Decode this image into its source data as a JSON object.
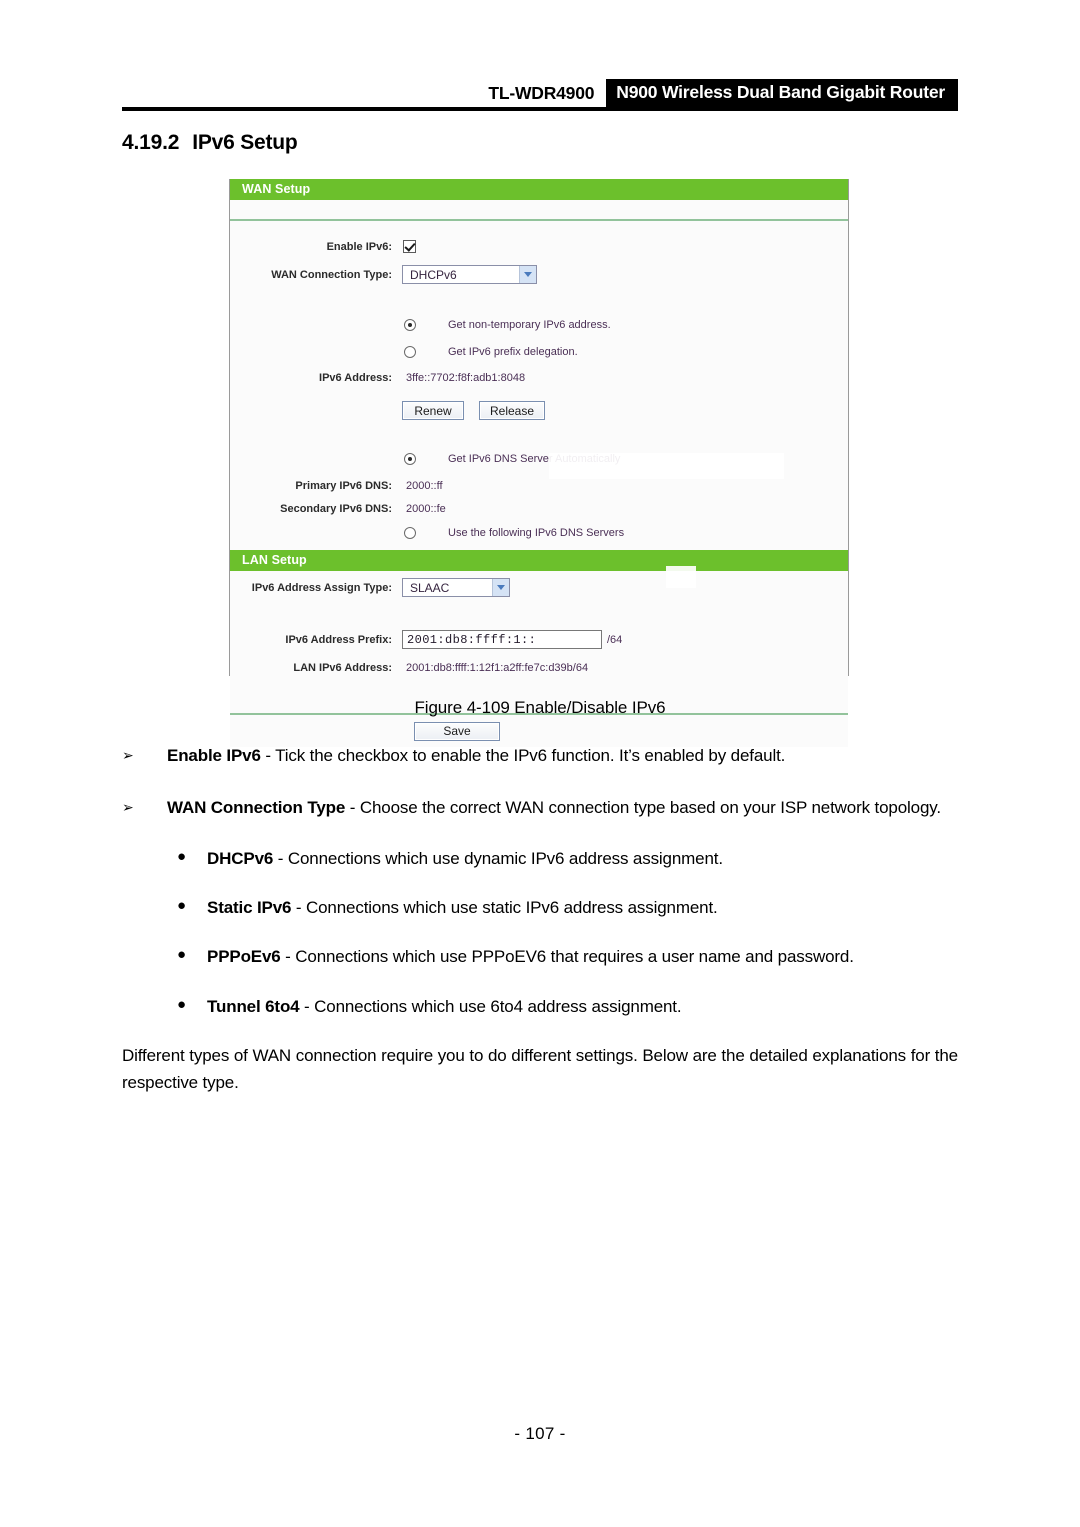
{
  "header": {
    "model": "TL-WDR4900",
    "product": "N900 Wireless Dual Band Gigabit Router"
  },
  "section": {
    "number": "4.19.2",
    "title": "IPv6 Setup"
  },
  "router_ui": {
    "wan_setup": {
      "panel_title": "WAN Setup",
      "enable_ipv6_label": "Enable IPv6:",
      "enable_ipv6_checked": "checked",
      "wan_connection_type_label": "WAN Connection Type:",
      "wan_connection_type_value": "DHCPv6",
      "radio_non_temporary": "Get non-temporary IPv6 address.",
      "radio_prefix_delegation": "Get IPv6 prefix delegation.",
      "ipv6_address_label": "IPv6 Address:",
      "ipv6_address_value": "3ffe::7702:f8f:adb1:8048",
      "renew_button": "Renew",
      "release_button": "Release",
      "radio_dns_auto": "Get IPv6 DNS Server Automatically",
      "primary_dns_label": "Primary IPv6 DNS:",
      "primary_dns_value": "2000::ff",
      "secondary_dns_label": "Secondary IPv6 DNS:",
      "secondary_dns_value": "2000::fe",
      "radio_dns_manual": "Use the following IPv6 DNS Servers"
    },
    "lan_setup": {
      "panel_title": "LAN Setup",
      "assign_type_label": "IPv6 Address Assign Type:",
      "assign_type_value": "SLAAC",
      "prefix_label": "IPv6 Address Prefix:",
      "prefix_value": "2001:db8:ffff:1::",
      "prefix_suffix": "/64",
      "lan_address_label": "LAN IPv6 Address:",
      "lan_address_value": "2001:db8:ffff:1:12f1:a2ff:fe7c:d39b/64"
    },
    "save_button": "Save",
    "colors": {
      "panel_header_green": "#6cc02c",
      "panel_background": "#fbfbfb",
      "value_text": "#4a2f55"
    }
  },
  "figure": {
    "caption": "Figure 4-109 Enable/Disable IPv6"
  },
  "body": {
    "arrow_items": [
      {
        "marker": "➢",
        "term": "Enable IPv6",
        "rest": " - Tick the checkbox to enable the IPv6 function. It’s enabled by default."
      },
      {
        "marker": "➢",
        "term": "WAN Connection Type",
        "rest": " - Choose the correct WAN connection type based on your ISP network topology."
      }
    ],
    "bullet_items": [
      {
        "marker": "●",
        "term": "DHCPv6",
        "rest": " - Connections which use dynamic IPv6 address assignment."
      },
      {
        "marker": "●",
        "term": "Static IPv6",
        "rest": " - Connections which use static IPv6 address assignment."
      },
      {
        "marker": "●",
        "term": "PPPoEv6",
        "rest": " - Connections which use PPPoEV6 that requires a user name and password."
      },
      {
        "marker": "●",
        "term": "Tunnel 6to4",
        "rest": " - Connections which use 6to4 address assignment."
      }
    ],
    "closing_paragraph": "Different types of WAN connection require you to do different settings. Below are the detailed explanations for the respective type."
  },
  "footer": {
    "page_number": "- 107 -"
  }
}
